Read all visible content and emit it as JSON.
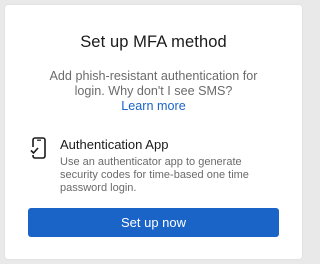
{
  "dialog": {
    "title": "Set up MFA method",
    "subtitle_lines": [
      "Add phish-resistant authentication for",
      "login. Why don't I see SMS?"
    ],
    "learn_more": "Learn more"
  },
  "method": {
    "icon": "phone-check-icon",
    "title": "Authentication App",
    "description_lines": [
      "Use an authenticator app to generate",
      "security codes for time-based one time",
      "password login."
    ]
  },
  "actions": {
    "setup_label": "Set up now"
  },
  "colors": {
    "accent": "#1a64c8",
    "background": "#e9e9e9",
    "card": "#ffffff",
    "muted_text": "#6b6b6b"
  }
}
